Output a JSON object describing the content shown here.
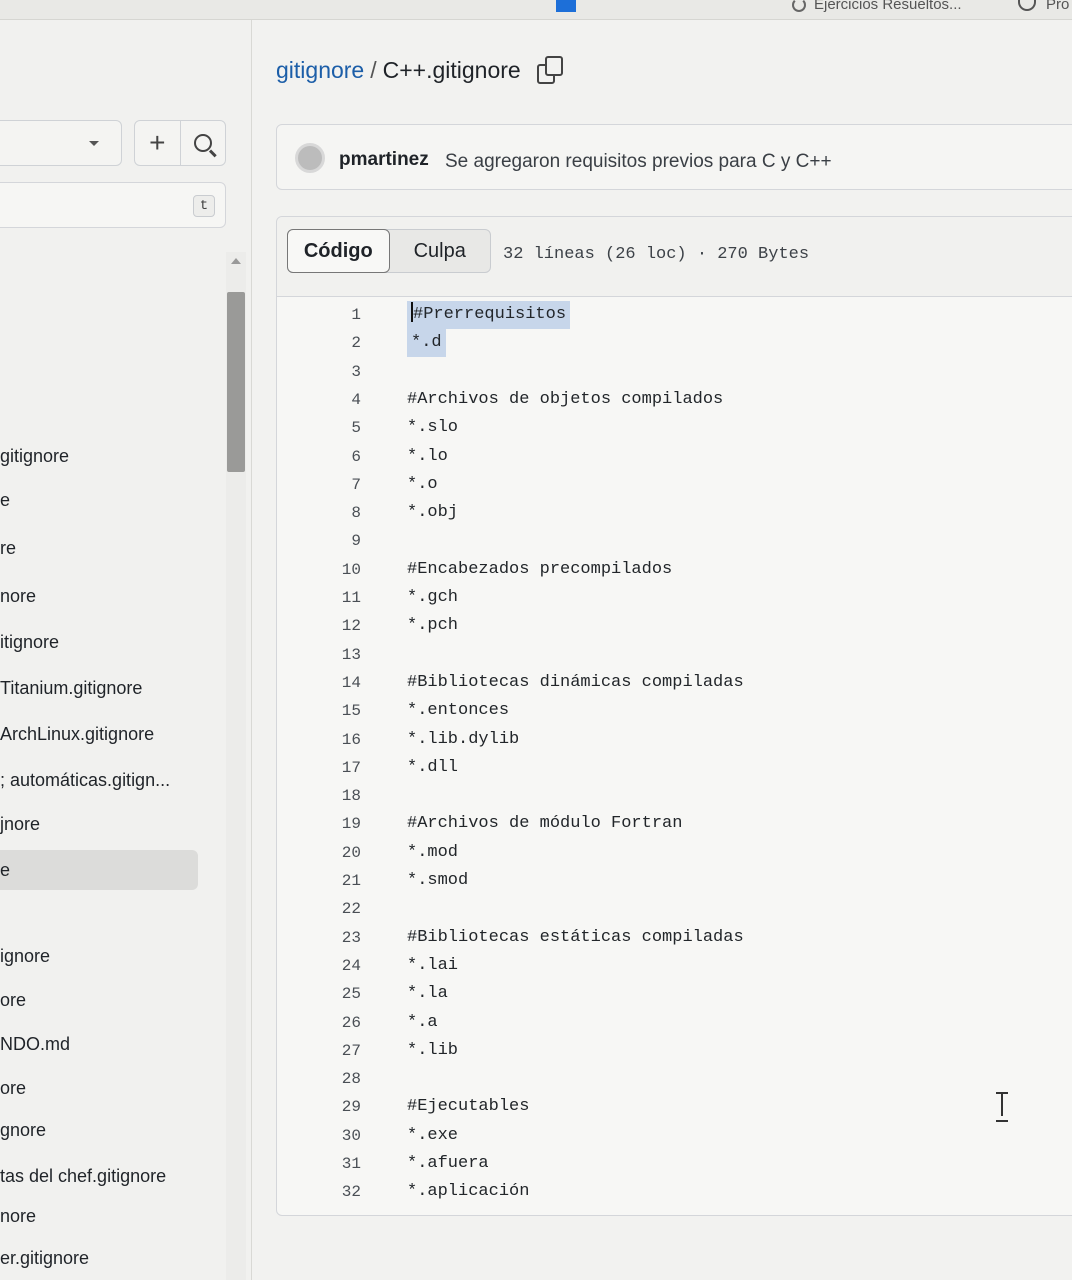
{
  "browser_tabs": [
    {
      "label": "Ejercicios Resueltos...",
      "icon": "loading-icon"
    },
    {
      "label": "Pro",
      "icon": "hook-icon"
    }
  ],
  "breadcrumb": {
    "repo": "gitignore",
    "separator": "/",
    "file": "C++.gitignore"
  },
  "sidebar": {
    "add_label": "+",
    "filter_shortcut": "t",
    "files": [
      {
        "label": "gitignore",
        "active": false
      },
      {
        "label": "e",
        "active": false
      },
      {
        "label": "re",
        "active": false
      },
      {
        "label": "nore",
        "active": false
      },
      {
        "label": "itignore",
        "active": false
      },
      {
        "label": "Titanium.gitignore",
        "active": false
      },
      {
        "label": "ArchLinux.gitignore",
        "active": false
      },
      {
        "label": "; automáticas.gitign...",
        "active": false
      },
      {
        "label": "jnore",
        "active": false
      },
      {
        "label": "e",
        "active": true
      },
      {
        "label": "ignore",
        "active": false
      },
      {
        "label": "ore",
        "active": false
      },
      {
        "label": "NDO.md",
        "active": false
      },
      {
        "label": "ore",
        "active": false
      },
      {
        "label": "gnore",
        "active": false
      },
      {
        "label": "tas del chef.gitignore",
        "active": false
      },
      {
        "label": "nore",
        "active": false
      },
      {
        "label": "er.gitignore",
        "active": false
      }
    ]
  },
  "commit": {
    "author": "pmartinez",
    "message": "Se agregaron requisitos previos para C y C++"
  },
  "code_view": {
    "tabs": [
      {
        "label": "Código",
        "active": true
      },
      {
        "label": "Culpa",
        "active": false
      }
    ],
    "meta": "32 líneas (26 loc) · 270 Bytes",
    "lines": [
      {
        "n": "1",
        "text": "#Prerrequisitos"
      },
      {
        "n": "2",
        "text": "*.d"
      },
      {
        "n": "3",
        "text": ""
      },
      {
        "n": "4",
        "text": "#Archivos de objetos compilados"
      },
      {
        "n": "5",
        "text": "*.slo"
      },
      {
        "n": "6",
        "text": "*.lo"
      },
      {
        "n": "7",
        "text": "*.o"
      },
      {
        "n": "8",
        "text": "*.obj"
      },
      {
        "n": "9",
        "text": ""
      },
      {
        "n": "10",
        "text": "#Encabezados precompilados"
      },
      {
        "n": "11",
        "text": "*.gch"
      },
      {
        "n": "12",
        "text": "*.pch"
      },
      {
        "n": "13",
        "text": ""
      },
      {
        "n": "14",
        "text": "#Bibliotecas dinámicas compiladas"
      },
      {
        "n": "15",
        "text": "*.entonces"
      },
      {
        "n": "16",
        "text": "*.lib.dylib"
      },
      {
        "n": "17",
        "text": "*.dll"
      },
      {
        "n": "18",
        "text": ""
      },
      {
        "n": "19",
        "text": "#Archivos de módulo Fortran"
      },
      {
        "n": "20",
        "text": "*.mod"
      },
      {
        "n": "21",
        "text": "*.smod"
      },
      {
        "n": "22",
        "text": ""
      },
      {
        "n": "23",
        "text": "#Bibliotecas estáticas compiladas"
      },
      {
        "n": "24",
        "text": "*.lai"
      },
      {
        "n": "25",
        "text": "*.la"
      },
      {
        "n": "26",
        "text": "*.a"
      },
      {
        "n": "27",
        "text": "*.lib"
      },
      {
        "n": "28",
        "text": ""
      },
      {
        "n": "29",
        "text": "#Ejecutables"
      },
      {
        "n": "30",
        "text": "*.exe"
      },
      {
        "n": "31",
        "text": "*.afuera"
      },
      {
        "n": "32",
        "text": "*.aplicación"
      }
    ],
    "selected_lines": [
      "1",
      "2"
    ]
  },
  "colors": {
    "link": "#1c5ea8",
    "selection": "#c7d6ea"
  }
}
